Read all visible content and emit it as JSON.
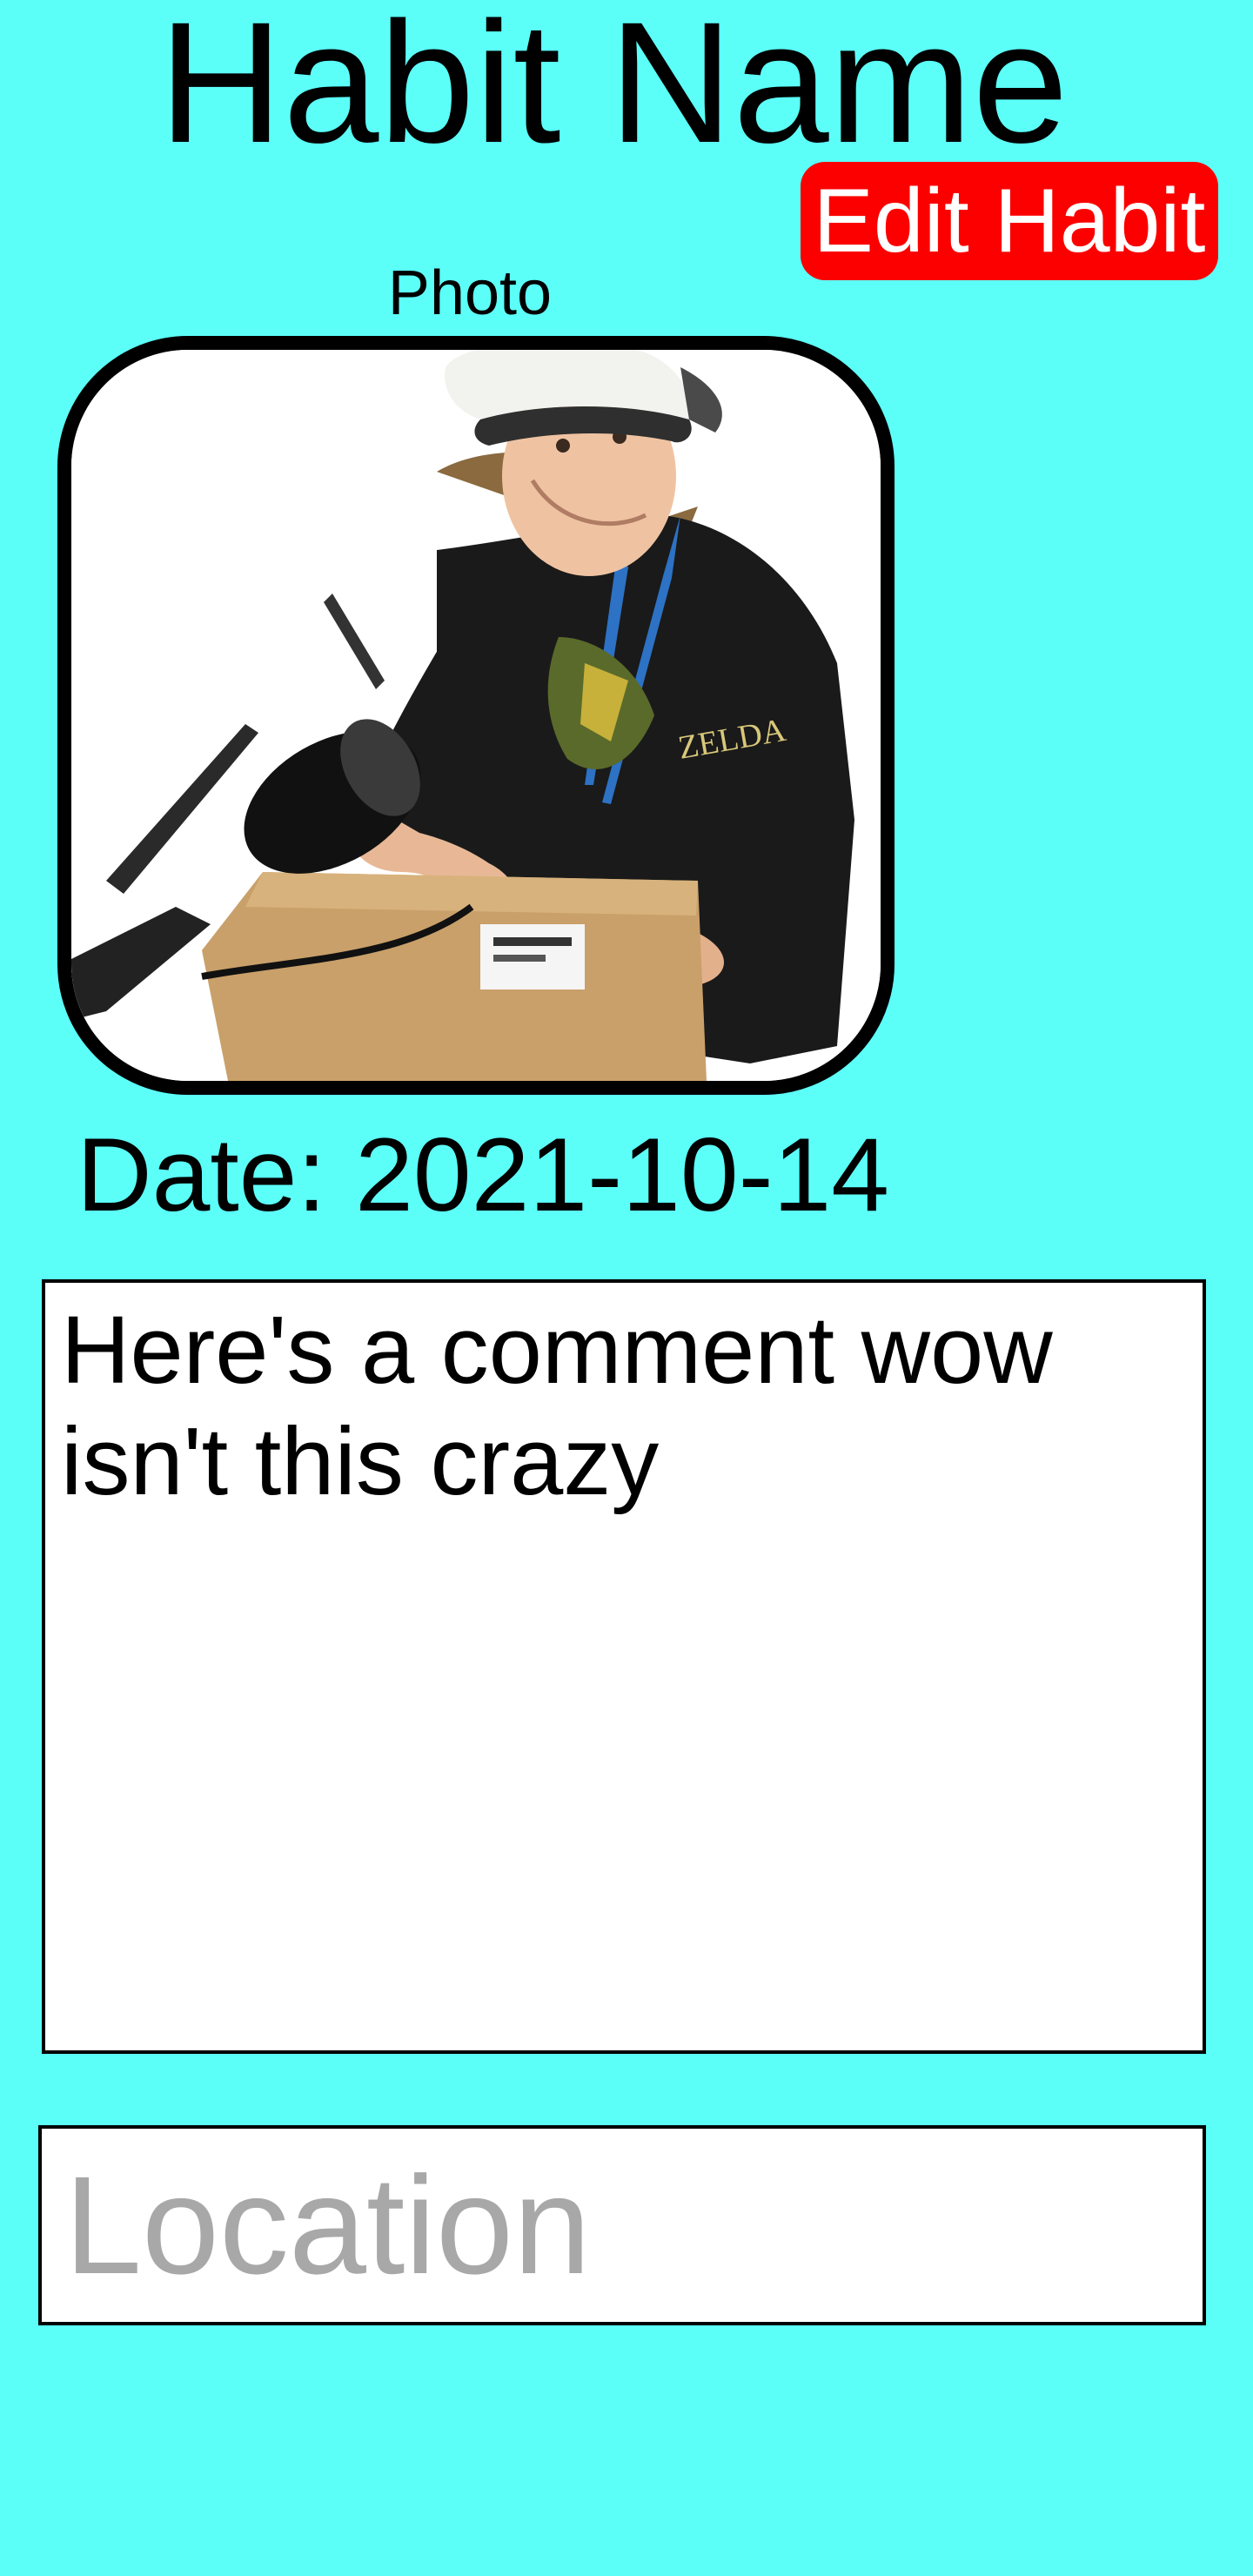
{
  "header": {
    "title": "Habit Name",
    "edit_button_label": "Edit Habit"
  },
  "photo": {
    "label": "Photo"
  },
  "event": {
    "date_label": "Date:",
    "date_value": "2021-10-14",
    "comment": "Here's a comment wow isn't this crazy"
  },
  "location": {
    "placeholder": "Location",
    "value": ""
  },
  "colors": {
    "background": "#5cfff8",
    "edit_button": "#fc0000"
  }
}
